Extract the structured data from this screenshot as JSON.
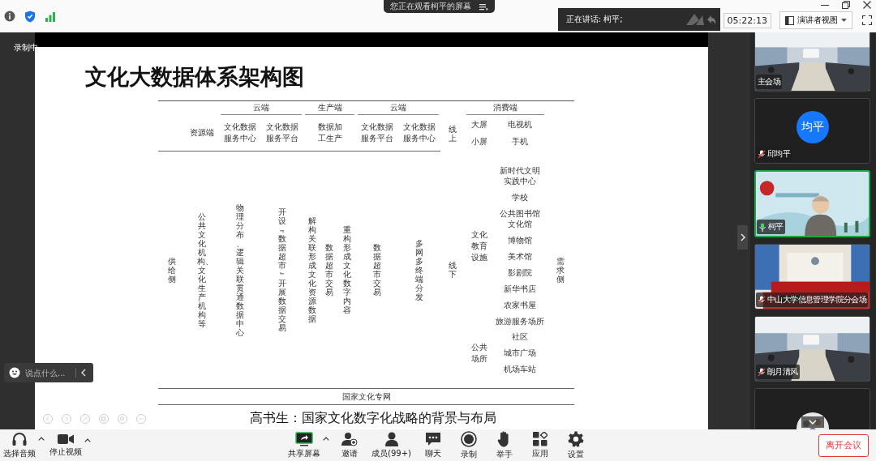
{
  "top_bar": {
    "screen_banner": "您正在观看柯平的屏幕",
    "speaking": "正在讲话: 柯平;",
    "timer": "05:22:13",
    "view_menu": "演讲者视图"
  },
  "recording": "录制中",
  "slide": {
    "title": "文化大数据体系架构图",
    "table": {
      "supply": "供给侧",
      "demand": "需求侧",
      "resource": {
        "header": "资源端",
        "body": "公共文化机构、文化生产机构等"
      },
      "segments": [
        {
          "group": "云端",
          "columns": [
            {
              "header": [
                "文化数据",
                "服务中心"
              ],
              "body": [
                "物理分布、逻辑关联贯通数据中心"
              ]
            },
            {
              "header": [
                "文化数据",
                "服务平台"
              ],
              "body": [
                "开设﹃数据超市﹄开展数据交易"
              ]
            }
          ]
        },
        {
          "group": "生产端",
          "columns": [
            {
              "header": [
                "数据加",
                "工生产"
              ],
              "body": [
                "解构关联形成文化资源数据",
                "数据超市交易",
                "重构形成文化数字内容"
              ]
            }
          ]
        },
        {
          "group": "云端",
          "columns": [
            {
              "header": [
                "文化数据",
                "服务平台"
              ],
              "body": [
                "数据超市交易"
              ]
            },
            {
              "header": [
                "文化数据",
                "服务中心"
              ],
              "body": [
                "多网多终端分发"
              ]
            }
          ]
        }
      ],
      "online": "线上",
      "offline": "线下",
      "consumer": {
        "group": "消费端",
        "screens": [
          {
            "label": "大屏",
            "item": "电视机"
          },
          {
            "label": "小屏",
            "item": "手机"
          }
        ],
        "venues": [
          {
            "label": [
              "文化",
              "教育",
              "设施"
            ],
            "items": [
              [
                "新时代文明",
                "实践中心"
              ],
              [
                "学校"
              ],
              [
                "公共图书馆",
                "文化馆"
              ],
              [
                "博物馆"
              ],
              [
                "美术馆"
              ],
              [
                "影剧院"
              ],
              [
                "新华书店"
              ],
              [
                "农家书屋"
              ],
              [
                "旅游服务场所"
              ]
            ]
          },
          {
            "label": [
              "公共",
              "场所"
            ],
            "items": [
              [
                "社区"
              ],
              [
                "城市广场"
              ],
              [
                "机场车站"
              ]
            ]
          }
        ]
      },
      "network": "国家文化专网"
    },
    "caption": "高书生：国家文化数字化战略的背景与布局"
  },
  "chat": {
    "placeholder": "说点什么..."
  },
  "participants": [
    {
      "name": "主会场",
      "kind": "picture",
      "speaking": false
    },
    {
      "name": "邱均平",
      "kind": "avatar",
      "avatar_text": "均平",
      "mic_muted": true,
      "speaking": false
    },
    {
      "name": "柯平",
      "kind": "picture",
      "mic_muted": false,
      "speaking": true
    },
    {
      "name": "中山大学信息管理学院分会场",
      "kind": "picture",
      "mic_muted": true,
      "speaking": false
    },
    {
      "name": "朗月清风",
      "kind": "picture",
      "mic_muted": true,
      "speaking": false
    },
    {
      "kind": "round-picture",
      "speaking": false
    }
  ],
  "toolbar": [
    {
      "kind": "audio",
      "label": "选择音频",
      "has_menu": true
    },
    {
      "kind": "video",
      "label": "停止视频",
      "has_menu": true
    },
    {
      "kind": "share",
      "label": "共享屏幕",
      "has_menu": true
    },
    {
      "kind": "invite",
      "label": "邀请",
      "has_menu": false
    },
    {
      "kind": "members",
      "label": "成员(99+)",
      "has_menu": false
    },
    {
      "kind": "chat",
      "label": "聊天",
      "has_menu": false
    },
    {
      "kind": "record",
      "label": "录制",
      "has_menu": false
    },
    {
      "kind": "hand",
      "label": "举手",
      "has_menu": false
    },
    {
      "kind": "apps",
      "label": "应用",
      "has_menu": false
    },
    {
      "kind": "settings",
      "label": "设置",
      "has_menu": false
    }
  ],
  "leave_button": "离开会议"
}
